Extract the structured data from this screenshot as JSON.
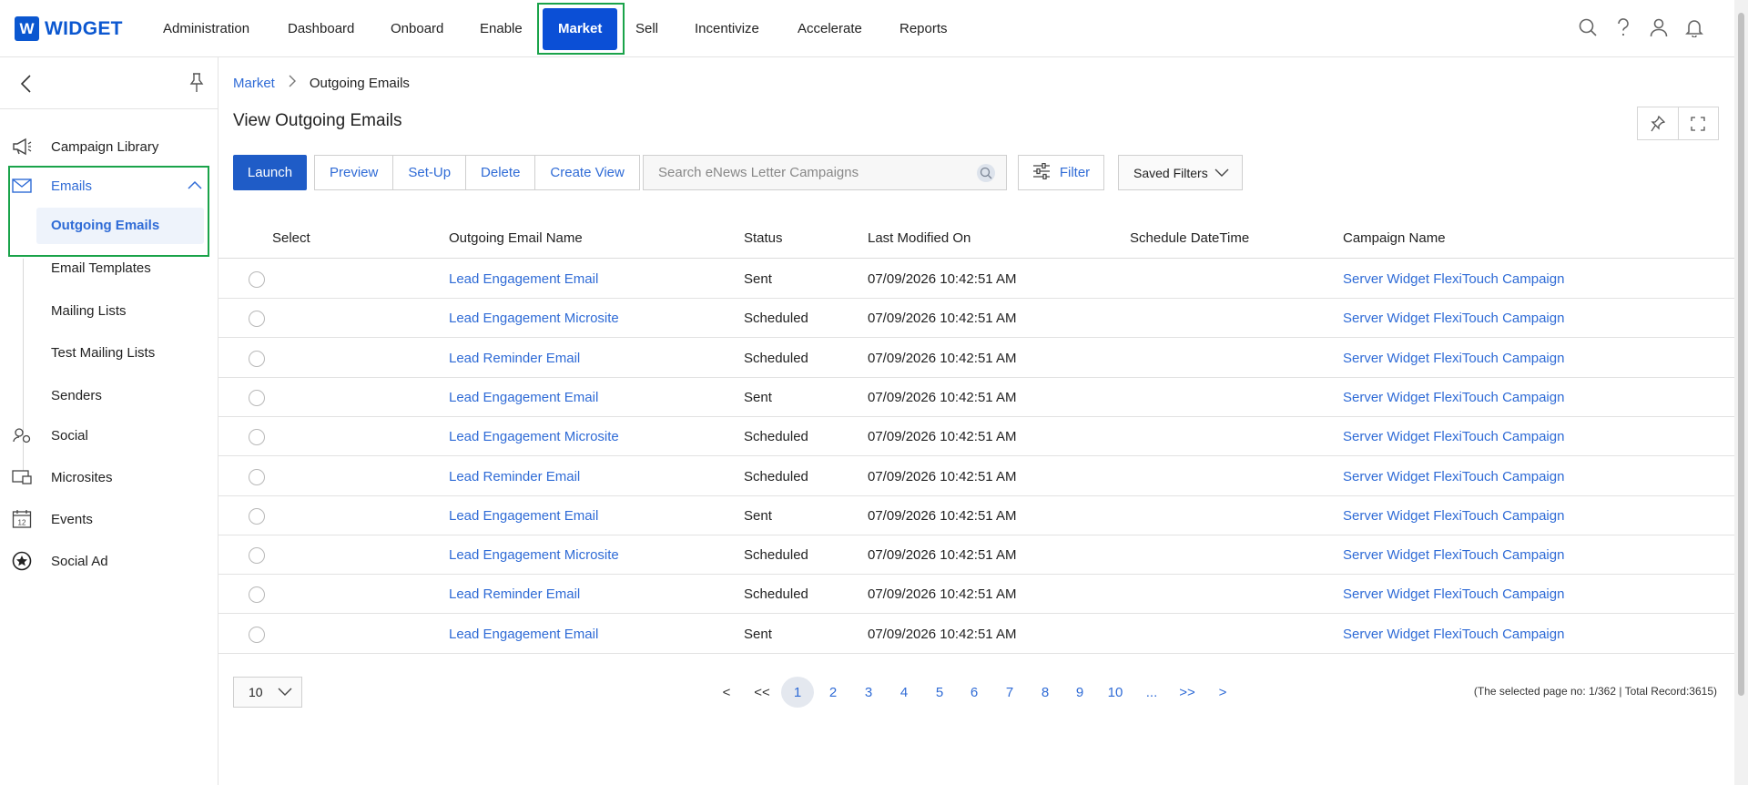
{
  "app": {
    "logo_letter": "W",
    "logo_text": "WIDGET",
    "brand_color": "#0b57d0",
    "highlight_color": "#1aa34a"
  },
  "nav": {
    "items": [
      {
        "label": "Administration"
      },
      {
        "label": "Dashboard"
      },
      {
        "label": "Onboard"
      },
      {
        "label": "Enable"
      },
      {
        "label": "Market",
        "active": true
      },
      {
        "label": "Sell"
      },
      {
        "label": "Incentivize"
      },
      {
        "label": "Accelerate"
      },
      {
        "label": "Reports"
      }
    ],
    "icons": [
      "search-icon",
      "help-icon",
      "user-icon",
      "bell-icon"
    ]
  },
  "sidebar": {
    "items": [
      {
        "label": "Campaign Library",
        "icon": "megaphone-icon"
      },
      {
        "label": "Emails",
        "icon": "envelope-icon",
        "expanded": true
      },
      {
        "label": "Social",
        "icon": "social-icon"
      },
      {
        "label": "Microsites",
        "icon": "microsite-icon"
      },
      {
        "label": "Events",
        "icon": "calendar-icon",
        "icon_text": "12"
      },
      {
        "label": "Social Ad",
        "icon": "star-circle-icon"
      }
    ],
    "email_sub": [
      {
        "label": "Outgoing Emails",
        "active": true
      },
      {
        "label": "Email Templates"
      },
      {
        "label": "Mailing Lists"
      },
      {
        "label": "Test Mailing Lists"
      },
      {
        "label": "Senders"
      }
    ]
  },
  "breadcrumb": {
    "parent": "Market",
    "current": "Outgoing Emails"
  },
  "page": {
    "title": "View Outgoing Emails"
  },
  "toolbar": {
    "launch": "Launch",
    "group": [
      "Preview",
      "Set-Up",
      "Delete",
      "Create View"
    ],
    "search_placeholder": "Search eNews Letter Campaigns",
    "filter": "Filter",
    "saved_filters": "Saved Filters"
  },
  "table": {
    "headers": [
      "Select",
      "Outgoing Email Name",
      "Status",
      "Last Modified On",
      "Schedule DateTime",
      "Campaign Name"
    ],
    "rows": [
      {
        "name": "Lead Engagement Email",
        "status": "Sent",
        "modified": "07/09/2026 10:42:51 AM",
        "schedule": "",
        "campaign": "Server Widget FlexiTouch Campaign"
      },
      {
        "name": "Lead Engagement Microsite",
        "status": "Scheduled",
        "modified": "07/09/2026 10:42:51 AM",
        "schedule": "",
        "campaign": "Server Widget FlexiTouch Campaign"
      },
      {
        "name": "Lead Reminder Email",
        "status": "Scheduled",
        "modified": "07/09/2026 10:42:51 AM",
        "schedule": "",
        "campaign": "Server Widget FlexiTouch Campaign"
      },
      {
        "name": "Lead Engagement Email",
        "status": "Sent",
        "modified": "07/09/2026 10:42:51 AM",
        "schedule": "",
        "campaign": "Server Widget FlexiTouch Campaign"
      },
      {
        "name": "Lead Engagement Microsite",
        "status": "Scheduled",
        "modified": "07/09/2026 10:42:51 AM",
        "schedule": "",
        "campaign": "Server Widget FlexiTouch Campaign"
      },
      {
        "name": "Lead Reminder Email",
        "status": "Scheduled",
        "modified": "07/09/2026 10:42:51 AM",
        "schedule": "",
        "campaign": "Server Widget FlexiTouch Campaign"
      },
      {
        "name": "Lead Engagement Email",
        "status": "Sent",
        "modified": "07/09/2026 10:42:51 AM",
        "schedule": "",
        "campaign": "Server Widget FlexiTouch Campaign"
      },
      {
        "name": "Lead Engagement Microsite",
        "status": "Scheduled",
        "modified": "07/09/2026 10:42:51 AM",
        "schedule": "",
        "campaign": "Server Widget FlexiTouch Campaign"
      },
      {
        "name": "Lead Reminder Email",
        "status": "Scheduled",
        "modified": "07/09/2026 10:42:51 AM",
        "schedule": "",
        "campaign": "Server Widget FlexiTouch Campaign"
      },
      {
        "name": "Lead Engagement Email",
        "status": "Sent",
        "modified": "07/09/2026 10:42:51 AM",
        "schedule": "",
        "campaign": "Server Widget FlexiTouch Campaign"
      }
    ]
  },
  "pagination": {
    "page_size": "10",
    "pages": [
      "<",
      "<<",
      "1",
      "2",
      "3",
      "4",
      "5",
      "6",
      "7",
      "8",
      "9",
      "10",
      "...",
      ">>",
      ">"
    ],
    "current": "1",
    "info": "(The selected page no: 1/362 | Total Record:3615)"
  }
}
